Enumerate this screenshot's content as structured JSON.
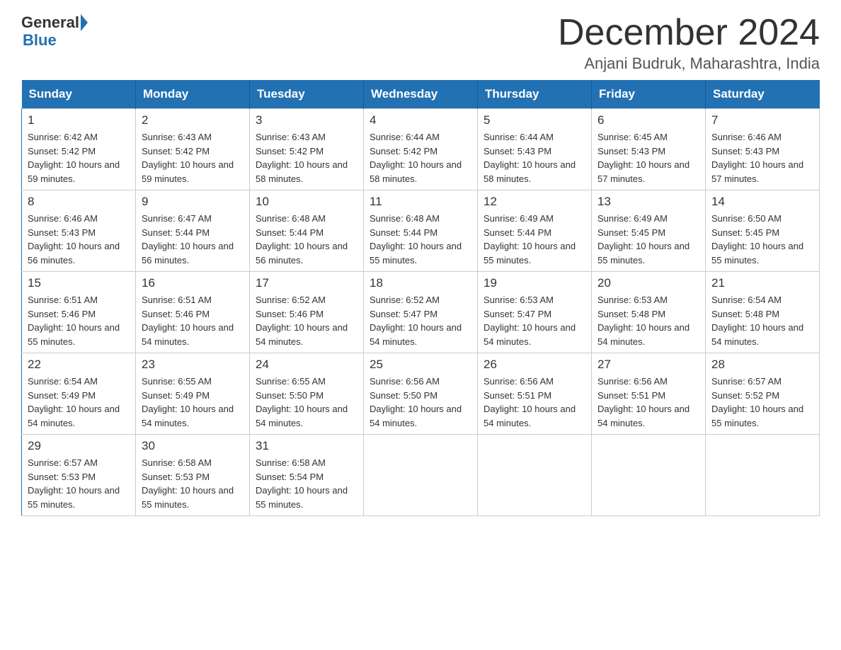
{
  "logo": {
    "text_before": "General",
    "text_after": "Blue"
  },
  "title": "December 2024",
  "location": "Anjani Budruk, Maharashtra, India",
  "days_of_week": [
    "Sunday",
    "Monday",
    "Tuesday",
    "Wednesday",
    "Thursday",
    "Friday",
    "Saturday"
  ],
  "weeks": [
    [
      {
        "day": "1",
        "sunrise": "Sunrise: 6:42 AM",
        "sunset": "Sunset: 5:42 PM",
        "daylight": "Daylight: 10 hours and 59 minutes."
      },
      {
        "day": "2",
        "sunrise": "Sunrise: 6:43 AM",
        "sunset": "Sunset: 5:42 PM",
        "daylight": "Daylight: 10 hours and 59 minutes."
      },
      {
        "day": "3",
        "sunrise": "Sunrise: 6:43 AM",
        "sunset": "Sunset: 5:42 PM",
        "daylight": "Daylight: 10 hours and 58 minutes."
      },
      {
        "day": "4",
        "sunrise": "Sunrise: 6:44 AM",
        "sunset": "Sunset: 5:42 PM",
        "daylight": "Daylight: 10 hours and 58 minutes."
      },
      {
        "day": "5",
        "sunrise": "Sunrise: 6:44 AM",
        "sunset": "Sunset: 5:43 PM",
        "daylight": "Daylight: 10 hours and 58 minutes."
      },
      {
        "day": "6",
        "sunrise": "Sunrise: 6:45 AM",
        "sunset": "Sunset: 5:43 PM",
        "daylight": "Daylight: 10 hours and 57 minutes."
      },
      {
        "day": "7",
        "sunrise": "Sunrise: 6:46 AM",
        "sunset": "Sunset: 5:43 PM",
        "daylight": "Daylight: 10 hours and 57 minutes."
      }
    ],
    [
      {
        "day": "8",
        "sunrise": "Sunrise: 6:46 AM",
        "sunset": "Sunset: 5:43 PM",
        "daylight": "Daylight: 10 hours and 56 minutes."
      },
      {
        "day": "9",
        "sunrise": "Sunrise: 6:47 AM",
        "sunset": "Sunset: 5:44 PM",
        "daylight": "Daylight: 10 hours and 56 minutes."
      },
      {
        "day": "10",
        "sunrise": "Sunrise: 6:48 AM",
        "sunset": "Sunset: 5:44 PM",
        "daylight": "Daylight: 10 hours and 56 minutes."
      },
      {
        "day": "11",
        "sunrise": "Sunrise: 6:48 AM",
        "sunset": "Sunset: 5:44 PM",
        "daylight": "Daylight: 10 hours and 55 minutes."
      },
      {
        "day": "12",
        "sunrise": "Sunrise: 6:49 AM",
        "sunset": "Sunset: 5:44 PM",
        "daylight": "Daylight: 10 hours and 55 minutes."
      },
      {
        "day": "13",
        "sunrise": "Sunrise: 6:49 AM",
        "sunset": "Sunset: 5:45 PM",
        "daylight": "Daylight: 10 hours and 55 minutes."
      },
      {
        "day": "14",
        "sunrise": "Sunrise: 6:50 AM",
        "sunset": "Sunset: 5:45 PM",
        "daylight": "Daylight: 10 hours and 55 minutes."
      }
    ],
    [
      {
        "day": "15",
        "sunrise": "Sunrise: 6:51 AM",
        "sunset": "Sunset: 5:46 PM",
        "daylight": "Daylight: 10 hours and 55 minutes."
      },
      {
        "day": "16",
        "sunrise": "Sunrise: 6:51 AM",
        "sunset": "Sunset: 5:46 PM",
        "daylight": "Daylight: 10 hours and 54 minutes."
      },
      {
        "day": "17",
        "sunrise": "Sunrise: 6:52 AM",
        "sunset": "Sunset: 5:46 PM",
        "daylight": "Daylight: 10 hours and 54 minutes."
      },
      {
        "day": "18",
        "sunrise": "Sunrise: 6:52 AM",
        "sunset": "Sunset: 5:47 PM",
        "daylight": "Daylight: 10 hours and 54 minutes."
      },
      {
        "day": "19",
        "sunrise": "Sunrise: 6:53 AM",
        "sunset": "Sunset: 5:47 PM",
        "daylight": "Daylight: 10 hours and 54 minutes."
      },
      {
        "day": "20",
        "sunrise": "Sunrise: 6:53 AM",
        "sunset": "Sunset: 5:48 PM",
        "daylight": "Daylight: 10 hours and 54 minutes."
      },
      {
        "day": "21",
        "sunrise": "Sunrise: 6:54 AM",
        "sunset": "Sunset: 5:48 PM",
        "daylight": "Daylight: 10 hours and 54 minutes."
      }
    ],
    [
      {
        "day": "22",
        "sunrise": "Sunrise: 6:54 AM",
        "sunset": "Sunset: 5:49 PM",
        "daylight": "Daylight: 10 hours and 54 minutes."
      },
      {
        "day": "23",
        "sunrise": "Sunrise: 6:55 AM",
        "sunset": "Sunset: 5:49 PM",
        "daylight": "Daylight: 10 hours and 54 minutes."
      },
      {
        "day": "24",
        "sunrise": "Sunrise: 6:55 AM",
        "sunset": "Sunset: 5:50 PM",
        "daylight": "Daylight: 10 hours and 54 minutes."
      },
      {
        "day": "25",
        "sunrise": "Sunrise: 6:56 AM",
        "sunset": "Sunset: 5:50 PM",
        "daylight": "Daylight: 10 hours and 54 minutes."
      },
      {
        "day": "26",
        "sunrise": "Sunrise: 6:56 AM",
        "sunset": "Sunset: 5:51 PM",
        "daylight": "Daylight: 10 hours and 54 minutes."
      },
      {
        "day": "27",
        "sunrise": "Sunrise: 6:56 AM",
        "sunset": "Sunset: 5:51 PM",
        "daylight": "Daylight: 10 hours and 54 minutes."
      },
      {
        "day": "28",
        "sunrise": "Sunrise: 6:57 AM",
        "sunset": "Sunset: 5:52 PM",
        "daylight": "Daylight: 10 hours and 55 minutes."
      }
    ],
    [
      {
        "day": "29",
        "sunrise": "Sunrise: 6:57 AM",
        "sunset": "Sunset: 5:53 PM",
        "daylight": "Daylight: 10 hours and 55 minutes."
      },
      {
        "day": "30",
        "sunrise": "Sunrise: 6:58 AM",
        "sunset": "Sunset: 5:53 PM",
        "daylight": "Daylight: 10 hours and 55 minutes."
      },
      {
        "day": "31",
        "sunrise": "Sunrise: 6:58 AM",
        "sunset": "Sunset: 5:54 PM",
        "daylight": "Daylight: 10 hours and 55 minutes."
      },
      null,
      null,
      null,
      null
    ]
  ]
}
